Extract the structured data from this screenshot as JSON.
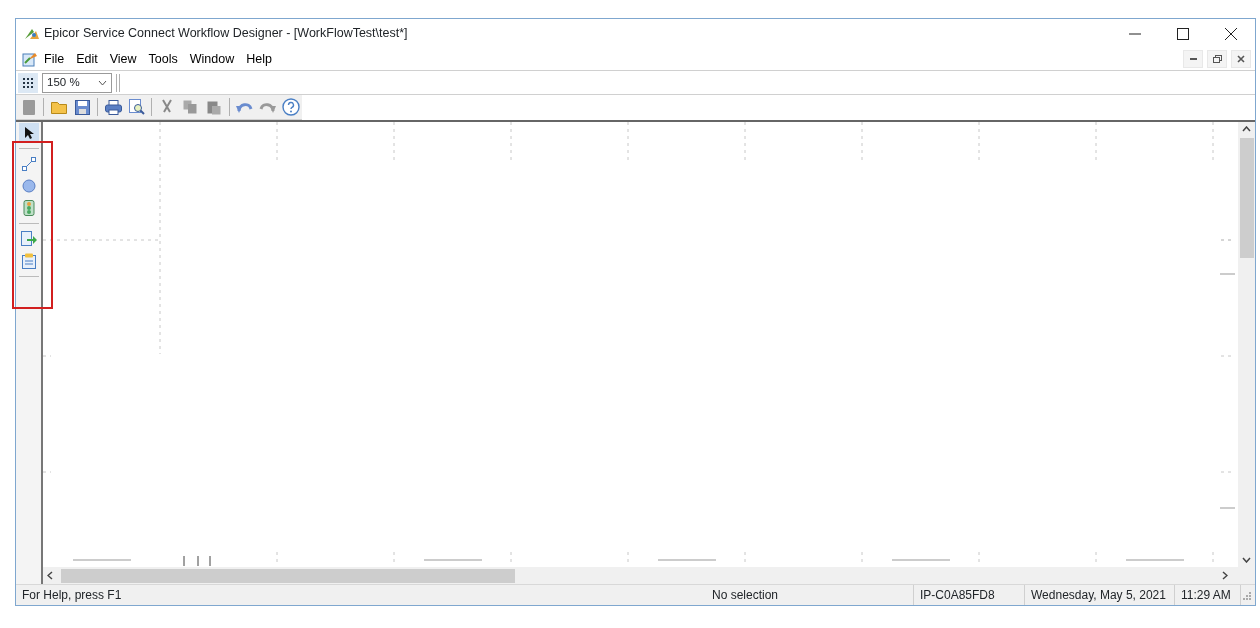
{
  "window": {
    "title": "Epicor Service Connect Workflow Designer - [WorkFlowTest\\test*]"
  },
  "menu": [
    "File",
    "Edit",
    "View",
    "Tools",
    "Window",
    "Help"
  ],
  "zoom": {
    "value": "150 %"
  },
  "status_bar": {
    "help": "For Help, press F1",
    "selection": "No selection",
    "machine": "IP-C0A85FD8",
    "date": "Wednesday, May 5, 2021",
    "time": "11:29 AM"
  }
}
